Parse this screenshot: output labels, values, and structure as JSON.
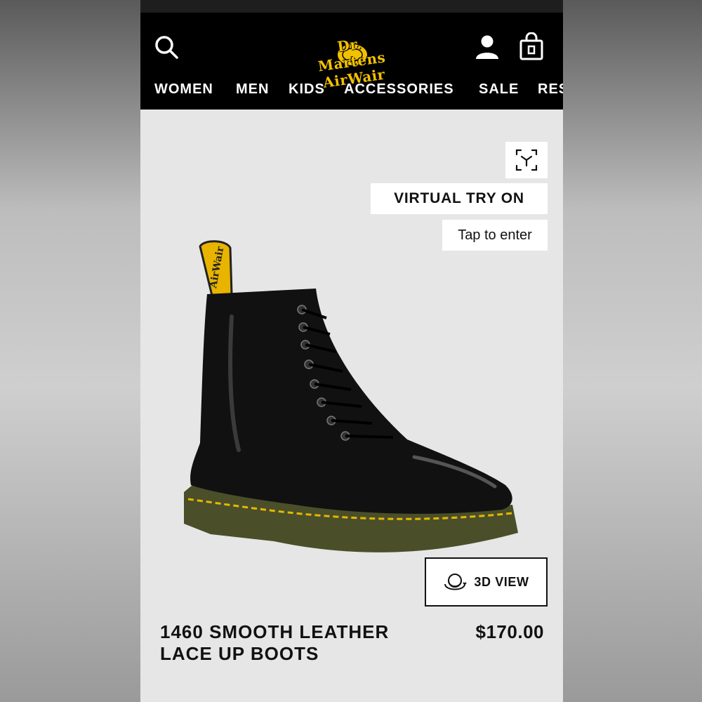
{
  "header": {
    "logo_text": "Dr. Martens AirWair",
    "nav": [
      {
        "label": "WOMEN"
      },
      {
        "label": "MEN"
      },
      {
        "label": "KIDS"
      },
      {
        "label": "ACCESSORIES"
      },
      {
        "label": "SALE"
      },
      {
        "label": "RES"
      }
    ],
    "icons": {
      "search": "search-icon",
      "account": "account-icon",
      "bag": "shopping-bag-icon"
    }
  },
  "hero": {
    "ar_icon": "ar-cube-icon",
    "virtual_try_on_label": "VIRTUAL TRY ON",
    "tap_to_enter_label": "Tap to enter",
    "view_3d_label": "3D VIEW",
    "view_3d_icon": "3d-rotate-icon"
  },
  "product": {
    "title": "1460 SMOOTH LEATHER LACE UP BOOTS",
    "price": "$170.00"
  },
  "colors": {
    "header_bg": "#000000",
    "brand_yellow": "#f2c200",
    "hero_bg": "#e6e6e6"
  }
}
